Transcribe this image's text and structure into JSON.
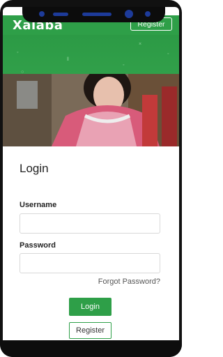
{
  "header": {
    "logo": "Xalaba",
    "register_label": "Register"
  },
  "login": {
    "title": "Login",
    "username_label": "Username",
    "username_value": "",
    "password_label": "Password",
    "password_value": "",
    "forgot_label": "Forgot Password?",
    "login_button": "Login",
    "register_button": "Register"
  },
  "colors": {
    "brand_green": "#2e9f48"
  }
}
